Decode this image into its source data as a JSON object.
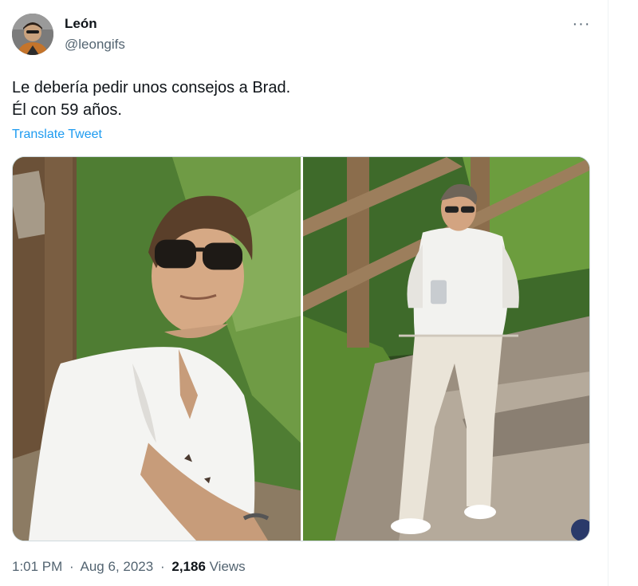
{
  "author": {
    "name": "León",
    "handle": "@leongifs"
  },
  "tweet": {
    "line1": "Le debería pedir unos consejos a Brad.",
    "line2": "Él con 59 años.",
    "translate_label": "Translate Tweet",
    "more_label": "···"
  },
  "meta": {
    "time": "1:01 PM",
    "date": "Aug 6, 2023",
    "separator": "·",
    "views_count": "2,186",
    "views_label": "Views"
  },
  "colors": {
    "link": "#1d9bf0",
    "secondary_text": "#536471",
    "primary_text": "#0f1419"
  }
}
